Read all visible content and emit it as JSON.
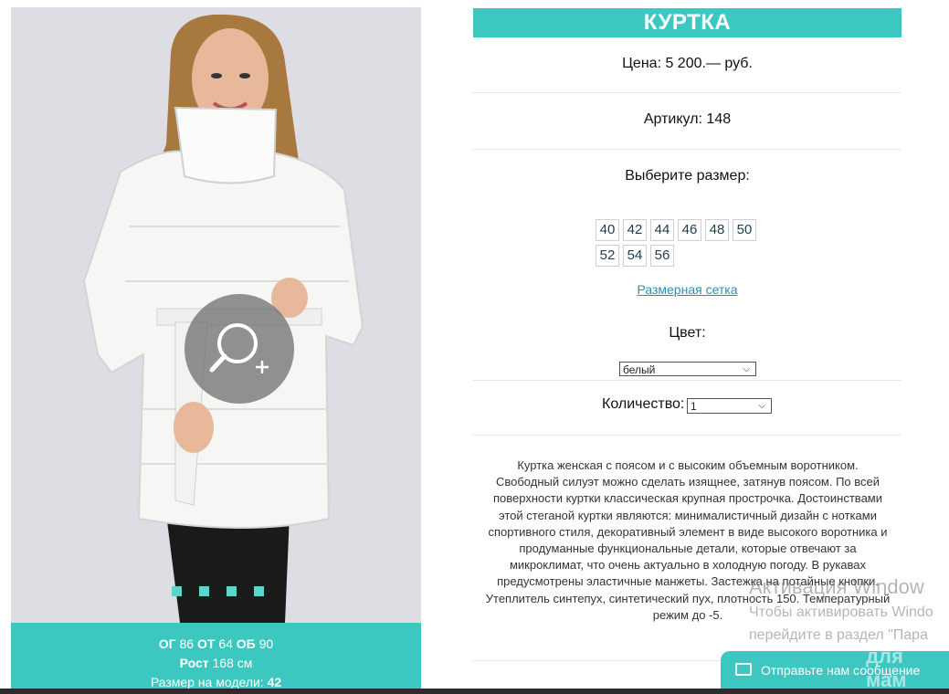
{
  "product": {
    "title": "КУРТКА",
    "price": "Цена: 5 200.— руб.",
    "article": "Артикул: 148",
    "size_prompt": "Выберите размер:",
    "sizes": [
      "40",
      "42",
      "44",
      "46",
      "48",
      "50",
      "52",
      "54",
      "56"
    ],
    "size_chart_link": "Размерная сетка",
    "color_label": "Цвет:",
    "color_value": "белый",
    "quantity_label": "Количество:",
    "quantity_value": "1",
    "description": "Куртка женская с поясом и с высоким объемным воротником. Свободный силуэт можно сделать изящнее, затянув поясом. По всей поверхности куртки классическая крупная прострочка. Достоинствами этой стеганой куртки являются: минималистичный дизайн с нотками спортивного стиля, декоративный элемент в виде высокого воротника и продуманные функциональные детали, которые отвечают за микроклимат, что очень актуально в холодную погоду. В рукавах предусмотрены эластичные манжеты. Застежка на потайные кнопки. Утеплитель синтепух, синтетический пух, плотность 150. Температурный режим до -5."
  },
  "model_info": {
    "og_label": "ОГ",
    "og_value": "86",
    "ot_label": "ОТ",
    "ot_value": "64",
    "ob_label": "ОБ",
    "ob_value": "90",
    "height_label": "Рост",
    "height_value": "168 см",
    "size_label": "Размер на модели:",
    "size_value": "42"
  },
  "windows_activation": {
    "line1": "Активация Window",
    "line2": "Чтобы активировать Windo",
    "line3": "перейдите в раздел \"Пара"
  },
  "chat": {
    "label": "Отправьте нам сообщение",
    "icon": "envelope-icon",
    "brand": "для мам"
  },
  "colors": {
    "accent": "#3cc8c0",
    "link": "#2a8fb7",
    "photo_bg": "#dedde3"
  }
}
